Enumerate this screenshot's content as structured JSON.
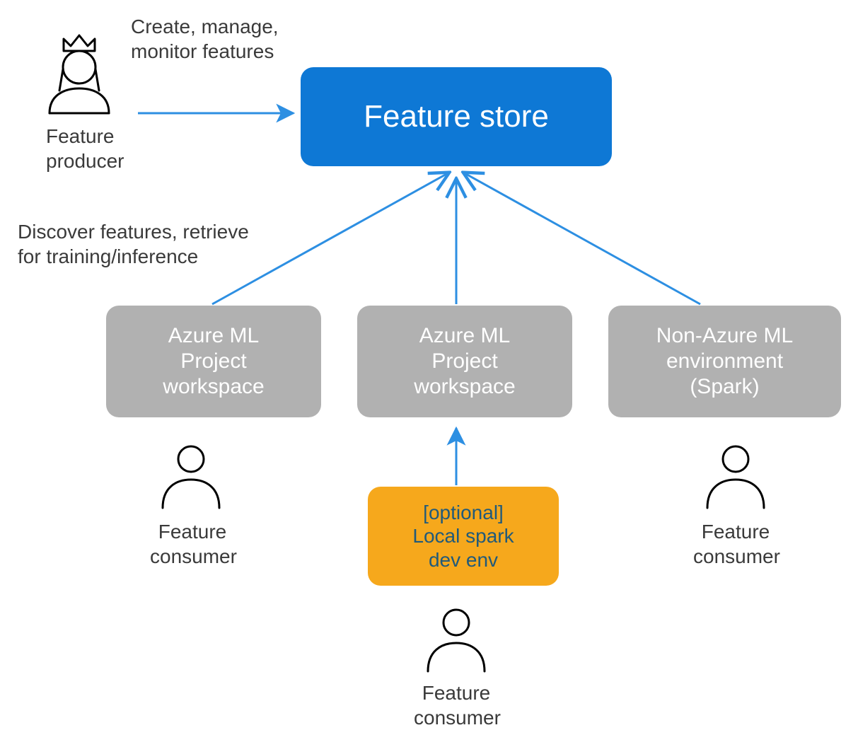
{
  "producer": {
    "action_label_line1": "Create, manage,",
    "action_label_line2": "monitor features",
    "role_line1": "Feature",
    "role_line2": "producer"
  },
  "feature_store": {
    "title": "Feature store"
  },
  "discover": {
    "line1": "Discover features, retrieve",
    "line2": "for training/inference"
  },
  "boxes": {
    "ws1_line1": "Azure ML",
    "ws1_line2": "Project",
    "ws1_line3": "workspace",
    "ws2_line1": "Azure ML",
    "ws2_line2": "Project",
    "ws2_line3": "workspace",
    "env_line1": "Non-Azure ML",
    "env_line2": "environment",
    "env_line3": "(Spark)",
    "local_line1": "[optional]",
    "local_line2": "Local spark",
    "local_line3": "dev env"
  },
  "consumer": {
    "line1": "Feature",
    "line2": "consumer"
  },
  "colors": {
    "blue": "#0e78d5",
    "gray": "#b1b1b1",
    "orange": "#f6a81c",
    "arrow": "#2d8fe2"
  }
}
